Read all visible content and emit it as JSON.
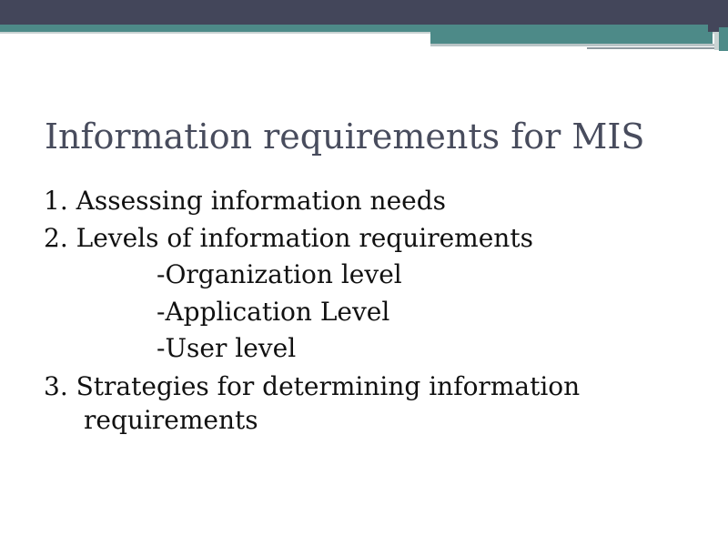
{
  "slide": {
    "title": "Information requirements for MIS",
    "items": [
      {
        "text": "1. Assessing information needs"
      },
      {
        "text": "2. Levels of information requirements"
      },
      {
        "text": "-Organization level"
      },
      {
        "text": "-Application Level"
      },
      {
        "text": "-User level"
      },
      {
        "text_line1": "3. Strategies for determining information",
        "text_line2": "requirements"
      }
    ]
  },
  "colors": {
    "banner_dark": "#43465a",
    "banner_teal": "#4d8a88",
    "title": "#484c5d",
    "body_text": "#111111",
    "background": "#ffffff"
  }
}
